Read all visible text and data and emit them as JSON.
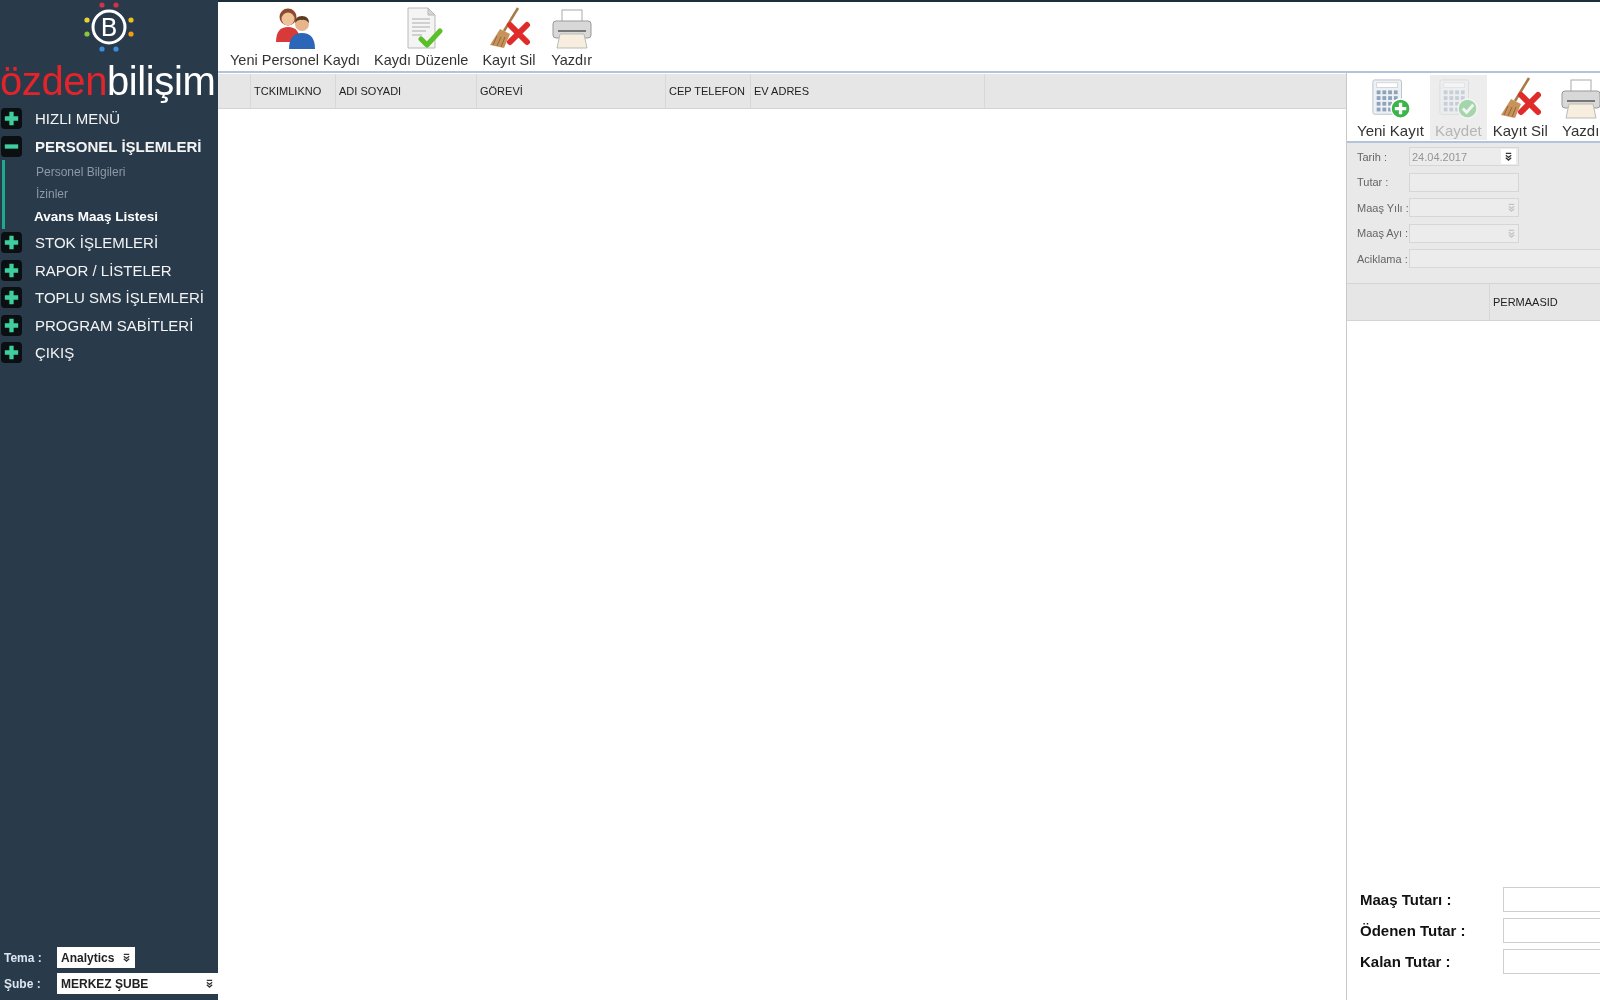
{
  "sidebar": {
    "logo": {
      "emblem_letter": "B",
      "name_accent": "özden",
      "name_rest": "bilişim"
    },
    "menu": [
      {
        "label": "HIZLI MENÜ",
        "expanded": false
      },
      {
        "label": "PERSONEL İŞLEMLERİ",
        "expanded": true,
        "children": [
          {
            "label": "Personel Bilgileri",
            "selected": false
          },
          {
            "label": "İzinler",
            "selected": false
          },
          {
            "label": "Avans Maaş Listesi",
            "selected": true
          }
        ]
      },
      {
        "label": "STOK İŞLEMLERİ",
        "expanded": false
      },
      {
        "label": "RAPOR / LİSTELER",
        "expanded": false
      },
      {
        "label": "TOPLU SMS İŞLEMLERİ",
        "expanded": false
      },
      {
        "label": "PROGRAM SABİTLERİ",
        "expanded": false
      },
      {
        "label": "ÇIKIŞ",
        "expanded": false
      }
    ],
    "settings": [
      {
        "label": "Tema :",
        "value": "Analytics"
      },
      {
        "label": "Şube :",
        "value": "MERKEZ ŞUBE"
      }
    ]
  },
  "toolbar": {
    "buttons": [
      {
        "label": "Yeni Personel Kaydı"
      },
      {
        "label": "Kaydı Düzenle"
      },
      {
        "label": "Kayıt Sil"
      },
      {
        "label": "Yazdır"
      }
    ]
  },
  "table": {
    "columns": [
      {
        "label": "TCKIMLIKNO"
      },
      {
        "label": "ADI SOYADI"
      },
      {
        "label": "GÖREVİ"
      },
      {
        "label": "CEP TELEFON"
      },
      {
        "label": "EV ADRES"
      }
    ]
  },
  "detail_panel": {
    "toolbar": {
      "buttons": [
        {
          "label": "Yeni Kayıt",
          "disabled": false
        },
        {
          "label": "Kaydet",
          "disabled": true
        },
        {
          "label": "Kayıt Sil",
          "disabled": false
        },
        {
          "label": "Yazdı",
          "disabled": false
        }
      ]
    },
    "form": {
      "fields": [
        {
          "label": "Tarih :",
          "kind": "date",
          "value": "24.04.2017",
          "disabled": true
        },
        {
          "label": "Tutar :",
          "kind": "text",
          "disabled": true
        },
        {
          "label": "Maaş Yılı :",
          "kind": "select",
          "disabled": true
        },
        {
          "label": "Maaş Ayı :",
          "kind": "select",
          "disabled": true
        },
        {
          "label": "Aciklama :",
          "kind": "longtext",
          "disabled": true
        }
      ]
    },
    "table": {
      "columns": [
        {
          "label": "PERMAASID"
        }
      ]
    },
    "totals": [
      {
        "label": "Maaş Tutarı :"
      },
      {
        "label": "Ödenen Tutar :"
      },
      {
        "label": "Kalan Tutar :"
      }
    ]
  }
}
